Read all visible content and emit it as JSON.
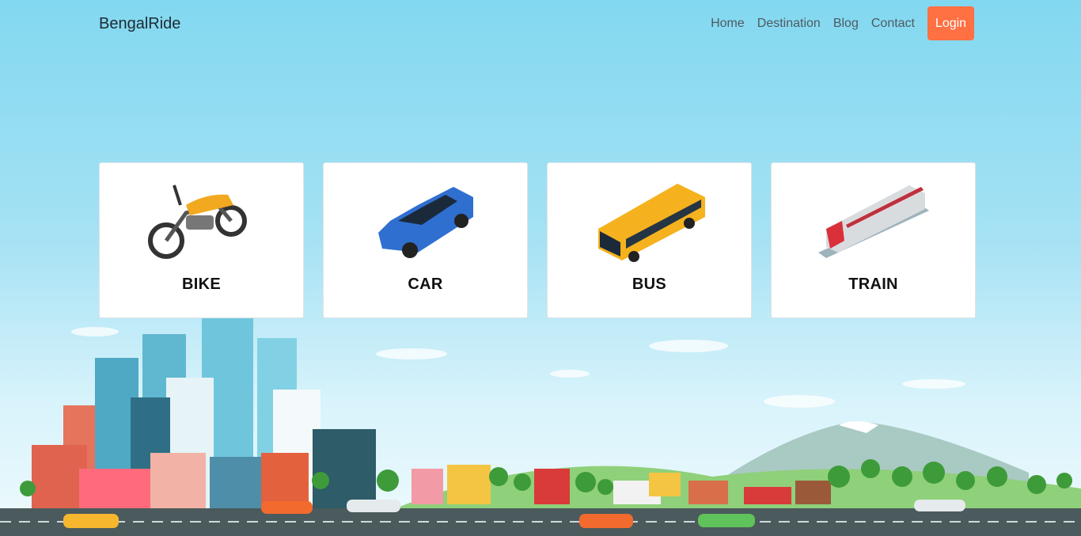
{
  "header": {
    "brand": "BengalRide",
    "nav": [
      "Home",
      "Destination",
      "Blog",
      "Contact"
    ],
    "login_label": "Login"
  },
  "cards": [
    {
      "label": "BIKE",
      "icon": "motorbike-icon"
    },
    {
      "label": "CAR",
      "icon": "car-icon"
    },
    {
      "label": "BUS",
      "icon": "bus-icon"
    },
    {
      "label": "TRAIN",
      "icon": "train-icon"
    }
  ],
  "colors": {
    "accent": "#ff7043",
    "sky_top": "#82d8f0",
    "road": "#4b5a5c"
  }
}
